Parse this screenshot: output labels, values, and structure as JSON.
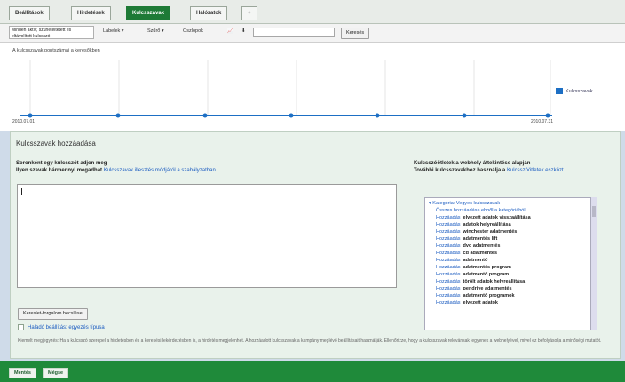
{
  "tabs": [
    {
      "label": "Beállítások"
    },
    {
      "label": "Hirdetések"
    },
    {
      "label": "Kulcsszavak"
    },
    {
      "label": "Hálózatok"
    },
    {
      "label": "+"
    }
  ],
  "toolbar": {
    "segment_select": "Minden aktív, szüneteltetett és eltávolított kulcsszó",
    "labels_menu": "Labelek",
    "filter_menu": "Szűrő",
    "columns_menu": "Oszlopok",
    "chart_icon": "chart-icon",
    "download_icon": "download-icon",
    "search_placeholder": "",
    "search_button": "Keresés"
  },
  "chart": {
    "label": "A kulcsszavak pontszámai a keresőkben",
    "legend": "Kulcsszavak",
    "date_start": "2010.07.01",
    "date_end": "2010.07.31",
    "series_color": "#1d6fc4"
  },
  "panel": {
    "title": "Kulcsszavak hozzáadása",
    "instruction": "Soronként egy kulcsszót adjon meg",
    "instruction_line2": "Ilyen szavak bármennyi megadhat",
    "instruction_link": "Kulcsszavak illesztés módjáról a szabályzatban",
    "textarea_value": "",
    "right_title": "Kulcsszóötletek a webhely áttekintése alapján",
    "right_line2": "További kulcsszavakhoz használja a",
    "right_link": "Kulcsszóötletek eszközt",
    "list": [
      {
        "add": "Kategória: Vegyes kulcsszavak",
        "kw": ""
      },
      {
        "add": "Összes hozzáadása ebből a kategóriából",
        "kw": ""
      },
      {
        "add": "Hozzáadás",
        "kw": "elvezett adatok visszaállítása"
      },
      {
        "add": "Hozzáadás",
        "kw": "adatok helyreállítása"
      },
      {
        "add": "Hozzáadás",
        "kw": "winchester adatmentés"
      },
      {
        "add": "Hozzáadás",
        "kw": "adatmentés lift"
      },
      {
        "add": "Hozzáadás",
        "kw": "dvd adatmentés"
      },
      {
        "add": "Hozzáadás",
        "kw": "cd adatmentés"
      },
      {
        "add": "Hozzáadás",
        "kw": "adatmentő"
      },
      {
        "add": "Hozzáadás",
        "kw": "adatmentés program"
      },
      {
        "add": "Hozzáadás",
        "kw": "adatmentő program"
      },
      {
        "add": "Hozzáadás",
        "kw": "törölt adatok helyreállítása"
      },
      {
        "add": "Hozzáadás",
        "kw": "pendrive adatmentés"
      },
      {
        "add": "Hozzáadás",
        "kw": "adatmentő programok"
      },
      {
        "add": "Hozzáadás",
        "kw": "elvezett adatok"
      }
    ],
    "estimate_button": "Kereslet-forgalom becslése",
    "advanced_label": "Haladó beállítás: egyezés típusa",
    "note": "Kiemelt megjegyzés: Ha a kulcsszó szerepel a hirdetésben és a keresési lekérdezésben is, a hirdetés megjelenhet. A hozzáadott kulcsszavak a kampány meglévő beállításait használják. Ellenőrizze, hogy a kulcsszavak relevánsak legyenek a webhelyével, mivel ez befolyásolja a minőségi mutatót."
  },
  "footer": {
    "save": "Mentés",
    "cancel": "Mégse"
  }
}
